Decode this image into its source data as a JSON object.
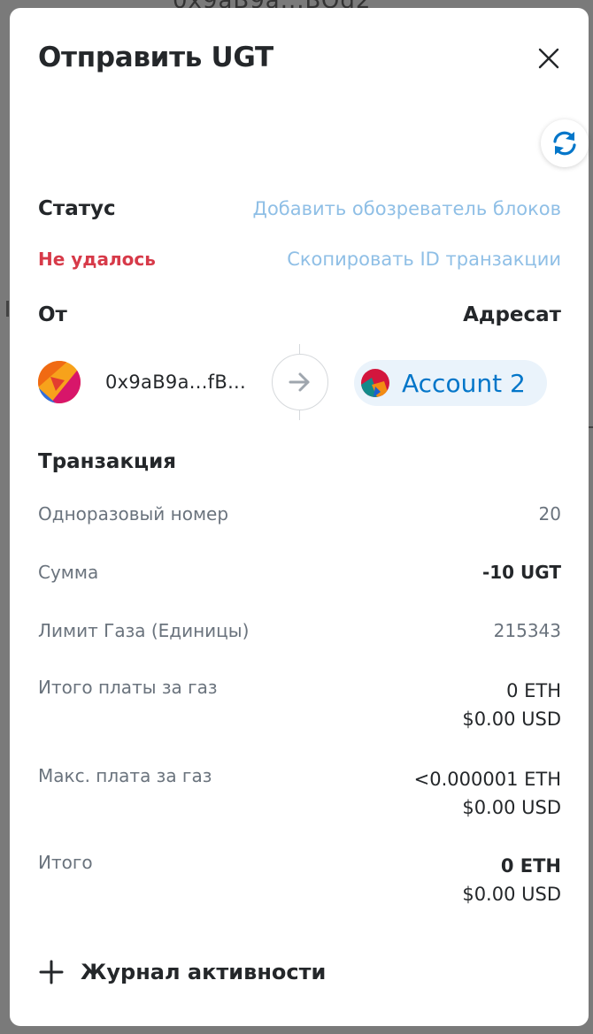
{
  "backdrop": {
    "address_fragment": "0x9aB9a...BOd2"
  },
  "modal": {
    "title": "Отправить UGT"
  },
  "status": {
    "label": "Статус",
    "value": "Не удалось",
    "add_explorer_link": "Добавить обозреватель блоков",
    "copy_tx_id_link": "Скопировать ID транзакции"
  },
  "parties": {
    "from_label": "От",
    "to_label": "Адресат",
    "from_address": "0x9aB9a...fB...",
    "to_account": "Account 2"
  },
  "transaction": {
    "heading": "Транзакция",
    "rows": [
      {
        "label": "Одноразовый номер",
        "value": "20"
      },
      {
        "label": "Сумма",
        "value": "-10 UGT"
      },
      {
        "label": "Лимит Газа (Единицы)",
        "value": "215343"
      },
      {
        "label": "Итого платы за газ",
        "value": "0 ETH",
        "value2": "$0.00 USD"
      },
      {
        "label": "Макс. плата за газ",
        "value": "<0.000001 ETH",
        "value2": "$0.00 USD"
      },
      {
        "label": "Итого",
        "value": "0 ETH",
        "value2": "$0.00 USD"
      }
    ]
  },
  "activity": {
    "label": "Журнал активности"
  },
  "colors": {
    "failed": "#d73a49",
    "link": "#8fbfe6",
    "accent": "#0376c9"
  }
}
